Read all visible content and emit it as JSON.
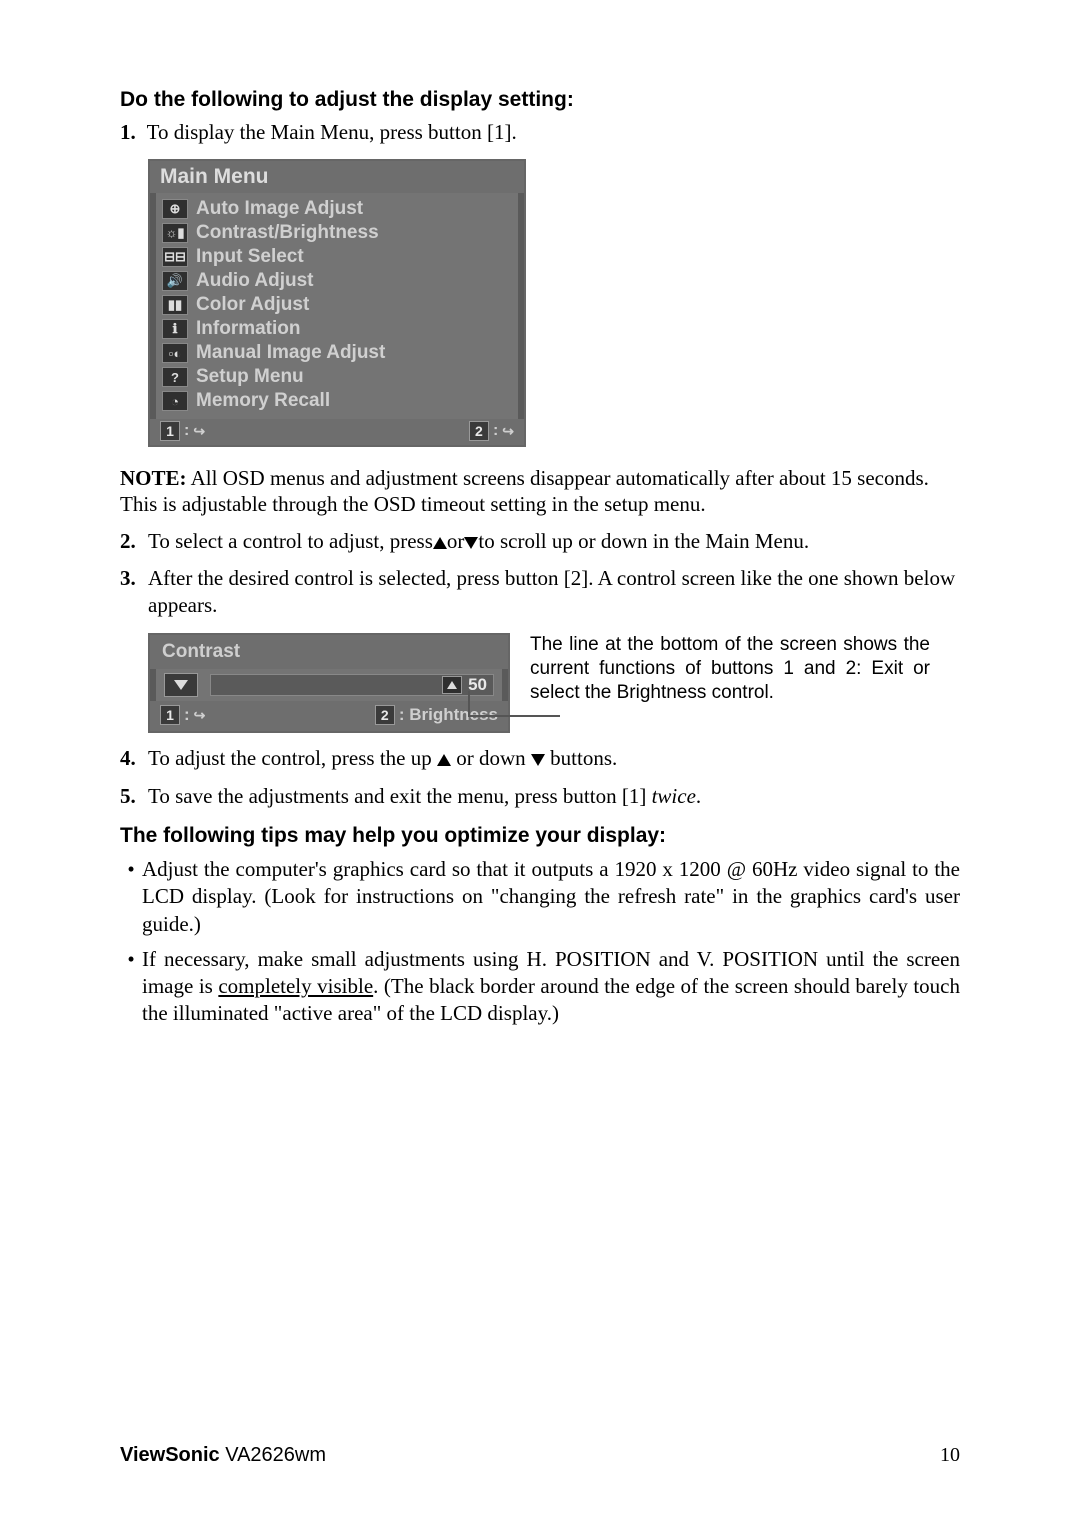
{
  "heading1": "Do the following to adjust the display setting:",
  "step1": "To display the Main Menu, press button [1].",
  "menu": {
    "title": "Main Menu",
    "items": [
      {
        "icon": "⊕",
        "label": "Auto Image Adjust"
      },
      {
        "icon": "☼▮",
        "label": "Contrast/Brightness"
      },
      {
        "icon": "⊟⊟",
        "label": "Input Select"
      },
      {
        "icon": "🔊",
        "label": "Audio Adjust"
      },
      {
        "icon": "▮▮",
        "label": "Color Adjust"
      },
      {
        "icon": "ℹ",
        "label": "Information"
      },
      {
        "icon": "▫◐",
        "label": "Manual Image Adjust"
      },
      {
        "icon": "?",
        "label": "Setup Menu"
      },
      {
        "icon": "◔",
        "label": "Memory Recall"
      }
    ],
    "footerLeft": "1",
    "footerRight": "2",
    "exitSym": "↪"
  },
  "note": {
    "prefix": "NOTE:",
    "text": " All OSD menus and adjustment screens disappear automatically after about 15 seconds. This is adjustable through the OSD timeout setting in the setup menu."
  },
  "step2a": "To select a control to adjust, press",
  "step2b": "or",
  "step2c": "to scroll up or down in the Main Menu.",
  "step3": "After the desired control is selected, press button [2]. A control screen like the one shown below appears.",
  "contrast": {
    "title": "Contrast",
    "value": "50",
    "bottomLeft": "1",
    "bottomRight": "2",
    "bottomLabel": ": Brightness"
  },
  "callout": "The line at the bottom of the screen shows the current functions of buttons 1 and 2: Exit or select the Brightness control.",
  "step4a": "To adjust the control, press the up ",
  "step4b": " or down ",
  "step4c": " buttons.",
  "step5a": "To save the adjustments and exit the menu, press button [1] ",
  "step5b": "twice",
  "step5c": ".",
  "tipsHeading": "The following tips may help you optimize your display:",
  "tip1": "Adjust the computer's graphics card so that it outputs a 1920 x 1200 @ 60Hz video signal to the LCD display. (Look for instructions on \"changing the refresh rate\" in the graphics card's user guide.)",
  "tip2a": "If necessary, make small adjustments using H. POSITION and V. POSITION until the screen image is ",
  "tip2b": "completely visible",
  "tip2c": ". (The black border around the edge of the screen should barely touch the illuminated \"active area\" of the LCD display.)",
  "footer": {
    "brand": "ViewSonic",
    "model": "   VA2626wm",
    "page": "10"
  }
}
